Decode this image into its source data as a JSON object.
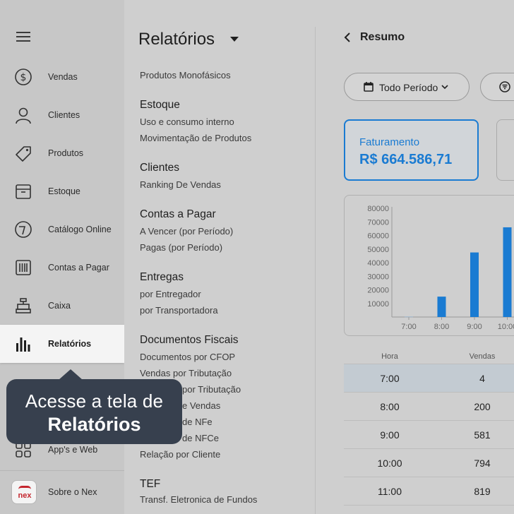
{
  "sidebar": {
    "items": [
      {
        "label": "Vendas",
        "icon": "dollar-circle-icon"
      },
      {
        "label": "Clientes",
        "icon": "user-icon"
      },
      {
        "label": "Produtos",
        "icon": "tag-icon"
      },
      {
        "label": "Estoque",
        "icon": "box-icon"
      },
      {
        "label": "Catálogo Online",
        "icon": "catalog-icon"
      },
      {
        "label": "Contas a Pagar",
        "icon": "barcode-icon"
      },
      {
        "label": "Caixa",
        "icon": "cash-register-icon"
      },
      {
        "label": "Relatórios",
        "icon": "bar-chart-icon",
        "active": true
      },
      {
        "label": "App's e Web",
        "icon": "apps-grid-icon"
      },
      {
        "label": "Sobre o Nex",
        "icon": "nex-logo-icon"
      }
    ],
    "logo_text": "nex"
  },
  "tooltip": {
    "line1": "Acesse a tela de",
    "line2": "Relatórios"
  },
  "reports": {
    "title": "Relatórios",
    "partial_item": "Produtos Monofásicos",
    "sections": [
      {
        "head": "Estoque",
        "items": [
          "Uso e consumo interno",
          "Movimentação de Produtos"
        ]
      },
      {
        "head": "Clientes",
        "items": [
          "Ranking De Vendas"
        ]
      },
      {
        "head": "Contas a Pagar",
        "items": [
          "A Vencer (por Período)",
          "Pagas (por Período)"
        ]
      },
      {
        "head": "Entregas",
        "items": [
          "por Entregador",
          "por Transportadora"
        ]
      },
      {
        "head": "Documentos Fiscais",
        "items": [
          "Documentos por CFOP",
          "Vendas por Tributação",
          "por Tributação",
          "e Vendas",
          "de NFe",
          "de NFCe",
          "Relação por Cliente"
        ]
      },
      {
        "head": "TEF",
        "items": [
          "Transf. Eletronica de Fundos"
        ]
      }
    ]
  },
  "summary": {
    "back_label": "Resumo",
    "period_filter": "Todo Período",
    "card": {
      "label": "Faturamento",
      "value": "R$ 664.586,71"
    },
    "accent": "#1a7bd2"
  },
  "chart_data": {
    "type": "bar",
    "categories": [
      "7:00",
      "8:00",
      "9:00",
      "10:00"
    ],
    "values": [
      400,
      15000,
      47500,
      66000
    ],
    "yticks": [
      10000,
      20000,
      30000,
      40000,
      50000,
      60000,
      70000,
      80000
    ],
    "ylim": [
      0,
      80000
    ],
    "color": "#1a7bd2"
  },
  "table": {
    "headers": [
      "Hora",
      "Vendas"
    ],
    "rows": [
      {
        "hora": "7:00",
        "vendas": "4"
      },
      {
        "hora": "8:00",
        "vendas": "200"
      },
      {
        "hora": "9:00",
        "vendas": "581"
      },
      {
        "hora": "10:00",
        "vendas": "794"
      },
      {
        "hora": "11:00",
        "vendas": "819"
      }
    ]
  }
}
